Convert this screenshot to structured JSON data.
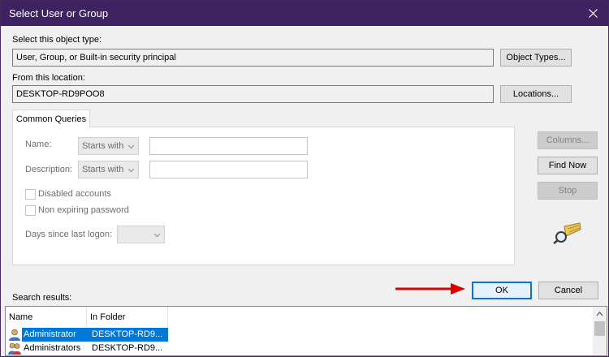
{
  "window": {
    "title": "Select User or Group"
  },
  "object_type": {
    "label": "Select this object type:",
    "value": "User, Group, or Built-in security principal",
    "button": "Object Types..."
  },
  "location": {
    "label": "From this location:",
    "value": "DESKTOP-RD9POO8",
    "button": "Locations..."
  },
  "queries": {
    "tab_label": "Common Queries",
    "name_label": "Name:",
    "name_mode": "Starts with",
    "description_label": "Description:",
    "description_mode": "Starts with",
    "disabled_accounts_label": "Disabled accounts",
    "non_expiring_label": "Non expiring password",
    "days_label": "Days since last logon:"
  },
  "side_buttons": {
    "columns": "Columns...",
    "find_now": "Find Now",
    "stop": "Stop"
  },
  "dialog_buttons": {
    "ok": "OK",
    "cancel": "Cancel"
  },
  "results": {
    "label": "Search results:",
    "columns": [
      "Name",
      "In Folder"
    ],
    "rows": [
      {
        "name": "Administrator",
        "folder": "DESKTOP-RD9...",
        "selected": true
      },
      {
        "name": "Administrators",
        "folder": "DESKTOP-RD9...",
        "selected": false
      }
    ]
  },
  "colors": {
    "titlebar": "#3e2261",
    "selection": "#0078d7",
    "annotation_arrow": "#e00000"
  },
  "icons": [
    "close-icon",
    "search-key-icon",
    "user-icon",
    "group-icon",
    "chevron-down-icon",
    "scroll-up-icon"
  ]
}
